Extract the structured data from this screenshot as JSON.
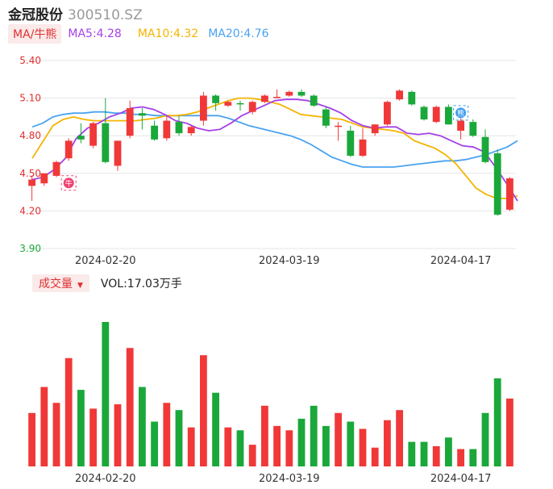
{
  "header": {
    "name": "金冠股份",
    "code": "300510.SZ"
  },
  "ma_legend": {
    "tag": "MA/牛熊",
    "ma5": "MA5:4.28",
    "ma10": "MA10:4.32",
    "ma20": "MA20:4.76"
  },
  "volume_legend": {
    "tag": "成交量",
    "caret": "▼",
    "vol": "VOL:17.03万手"
  },
  "markers": {
    "buy": "牛",
    "sell": "熊"
  },
  "colors": {
    "up": "#f03838",
    "down": "#1aa83a",
    "ma5": "#a640e8",
    "ma10": "#f4b400",
    "ma20": "#4aa3f0",
    "axis_text_up": "#e03030",
    "axis_text_down": "#1aa83a",
    "grid": "#e6e6e6"
  },
  "chart_data": [
    {
      "type": "candlestick",
      "title": "",
      "ylim": [
        3.9,
        5.4
      ],
      "yticks": [
        "5.40",
        "5.10",
        "4.80",
        "4.50",
        "4.20",
        "3.90"
      ],
      "xticks": [
        {
          "index": 6,
          "label": "2024-02-20"
        },
        {
          "index": 21,
          "label": "2024-03-19"
        },
        {
          "index": 35,
          "label": "2024-04-17"
        }
      ],
      "candles": [
        {
          "o": 4.4,
          "h": 4.48,
          "l": 4.28,
          "c": 4.45
        },
        {
          "o": 4.42,
          "h": 4.5,
          "l": 4.4,
          "c": 4.5
        },
        {
          "o": 4.48,
          "h": 4.6,
          "l": 4.47,
          "c": 4.59
        },
        {
          "o": 4.62,
          "h": 4.78,
          "l": 4.6,
          "c": 4.76
        },
        {
          "o": 4.8,
          "h": 4.9,
          "l": 4.74,
          "c": 4.77
        },
        {
          "o": 4.72,
          "h": 4.91,
          "l": 4.7,
          "c": 4.9
        },
        {
          "o": 4.9,
          "h": 5.1,
          "l": 4.58,
          "c": 4.59
        },
        {
          "o": 4.56,
          "h": 4.76,
          "l": 4.52,
          "c": 4.76
        },
        {
          "o": 4.8,
          "h": 5.08,
          "l": 4.78,
          "c": 5.02
        },
        {
          "o": 4.98,
          "h": 5.02,
          "l": 4.85,
          "c": 4.96
        },
        {
          "o": 4.88,
          "h": 4.92,
          "l": 4.76,
          "c": 4.77
        },
        {
          "o": 4.78,
          "h": 4.96,
          "l": 4.76,
          "c": 4.92
        },
        {
          "o": 4.91,
          "h": 4.96,
          "l": 4.8,
          "c": 4.82
        },
        {
          "o": 4.82,
          "h": 4.88,
          "l": 4.8,
          "c": 4.87
        },
        {
          "o": 4.92,
          "h": 5.15,
          "l": 4.88,
          "c": 5.12
        },
        {
          "o": 5.12,
          "h": 5.13,
          "l": 5.0,
          "c": 5.06
        },
        {
          "o": 5.04,
          "h": 5.08,
          "l": 5.03,
          "c": 5.07
        },
        {
          "o": 5.06,
          "h": 5.08,
          "l": 5.0,
          "c": 5.05
        },
        {
          "o": 4.99,
          "h": 5.08,
          "l": 4.97,
          "c": 5.07
        },
        {
          "o": 5.07,
          "h": 5.13,
          "l": 5.06,
          "c": 5.12
        },
        {
          "o": 5.11,
          "h": 5.17,
          "l": 5.1,
          "c": 5.11
        },
        {
          "o": 5.12,
          "h": 5.16,
          "l": 5.11,
          "c": 5.15
        },
        {
          "o": 5.15,
          "h": 5.17,
          "l": 5.11,
          "c": 5.12
        },
        {
          "o": 5.12,
          "h": 5.13,
          "l": 5.03,
          "c": 5.04
        },
        {
          "o": 5.01,
          "h": 5.03,
          "l": 4.86,
          "c": 4.88
        },
        {
          "o": 4.88,
          "h": 4.91,
          "l": 4.76,
          "c": 4.88
        },
        {
          "o": 4.84,
          "h": 4.88,
          "l": 4.63,
          "c": 4.64
        },
        {
          "o": 4.64,
          "h": 4.86,
          "l": 4.63,
          "c": 4.77
        },
        {
          "o": 4.82,
          "h": 4.89,
          "l": 4.8,
          "c": 4.89
        },
        {
          "o": 4.89,
          "h": 5.08,
          "l": 4.88,
          "c": 5.07
        },
        {
          "o": 5.09,
          "h": 5.17,
          "l": 5.08,
          "c": 5.16
        },
        {
          "o": 5.15,
          "h": 5.16,
          "l": 5.04,
          "c": 5.05
        },
        {
          "o": 5.03,
          "h": 5.04,
          "l": 4.92,
          "c": 4.93
        },
        {
          "o": 4.91,
          "h": 5.04,
          "l": 4.9,
          "c": 5.03
        },
        {
          "o": 5.03,
          "h": 5.05,
          "l": 4.89,
          "c": 4.89
        },
        {
          "o": 4.84,
          "h": 4.94,
          "l": 4.77,
          "c": 4.92
        },
        {
          "o": 4.91,
          "h": 4.93,
          "l": 4.79,
          "c": 4.8
        },
        {
          "o": 4.79,
          "h": 4.85,
          "l": 4.58,
          "c": 4.59
        },
        {
          "o": 4.66,
          "h": 4.69,
          "l": 4.16,
          "c": 4.17
        },
        {
          "o": 4.21,
          "h": 4.47,
          "l": 4.2,
          "c": 4.46
        }
      ],
      "ma": {
        "ma5": [
          4.45,
          4.47,
          4.53,
          4.62,
          4.78,
          4.86,
          4.9,
          4.95,
          4.98,
          5.02,
          5.03,
          5.01,
          4.97,
          4.92,
          4.9,
          4.86,
          4.84,
          4.85,
          4.9,
          4.96,
          5.0,
          5.04,
          5.08,
          5.09,
          5.09,
          5.08,
          5.05,
          5.02,
          4.98,
          4.92,
          4.88,
          4.86,
          4.87,
          4.87,
          4.82,
          4.81,
          4.82,
          4.8,
          4.76,
          4.72,
          4.71,
          4.67,
          4.55,
          4.42,
          4.28
        ],
        "ma10": [
          4.62,
          4.75,
          4.88,
          4.93,
          4.95,
          4.93,
          4.92,
          4.92,
          4.92,
          4.92,
          4.92,
          4.93,
          4.94,
          4.96,
          4.96,
          4.97,
          4.99,
          5.02,
          5.05,
          5.08,
          5.1,
          5.1,
          5.09,
          5.07,
          5.05,
          5.01,
          4.97,
          4.96,
          4.95,
          4.94,
          4.93,
          4.9,
          4.87,
          4.86,
          4.85,
          4.84,
          4.82,
          4.76,
          4.73,
          4.7,
          4.65,
          4.58,
          4.48,
          4.38,
          4.33,
          4.3,
          4.3,
          4.32
        ],
        "ma20": [
          4.87,
          4.9,
          4.95,
          4.97,
          4.98,
          4.98,
          4.99,
          4.99,
          4.98,
          4.98,
          4.97,
          4.97,
          4.96,
          4.96,
          4.96,
          4.96,
          4.96,
          4.96,
          4.96,
          4.94,
          4.91,
          4.88,
          4.86,
          4.84,
          4.82,
          4.8,
          4.77,
          4.73,
          4.68,
          4.63,
          4.6,
          4.57,
          4.55,
          4.55,
          4.55,
          4.55,
          4.56,
          4.57,
          4.58,
          4.59,
          4.6,
          4.6,
          4.61,
          4.63,
          4.65,
          4.68,
          4.71,
          4.76
        ]
      },
      "signals": [
        {
          "index": 3,
          "type": "buy",
          "value": 4.5
        },
        {
          "index": 35,
          "type": "sell",
          "value": 5.06
        }
      ]
    },
    {
      "type": "bar",
      "title": "",
      "ylim": [
        0,
        1.0
      ],
      "xticks": [
        {
          "index": 6,
          "label": "2024-02-20"
        },
        {
          "index": 21,
          "label": "2024-03-19"
        },
        {
          "index": 35,
          "label": "2024-04-17"
        }
      ],
      "values": [
        0.37,
        0.55,
        0.44,
        0.75,
        0.53,
        0.4,
        1.0,
        0.43,
        0.82,
        0.55,
        0.31,
        0.44,
        0.39,
        0.27,
        0.77,
        0.51,
        0.27,
        0.25,
        0.15,
        0.42,
        0.28,
        0.25,
        0.33,
        0.42,
        0.28,
        0.37,
        0.31,
        0.26,
        0.13,
        0.32,
        0.39,
        0.17,
        0.17,
        0.14,
        0.2,
        0.12,
        0.12,
        0.37,
        0.61,
        0.47
      ]
    }
  ]
}
